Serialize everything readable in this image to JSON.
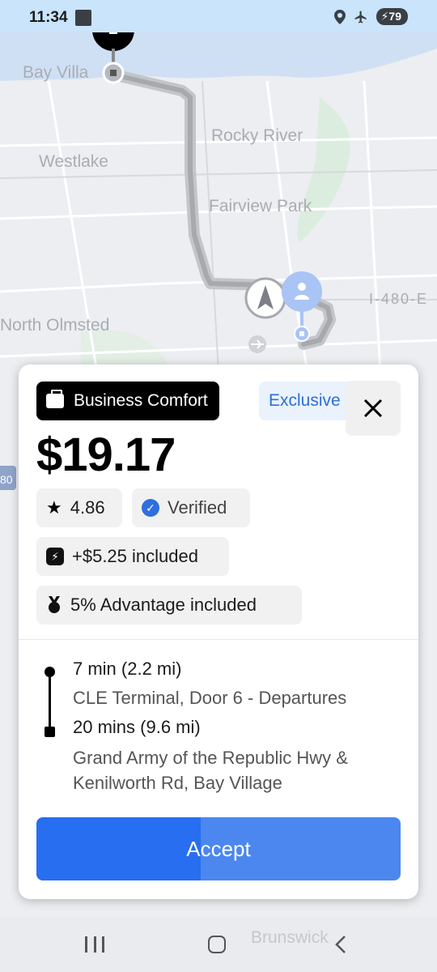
{
  "status_bar": {
    "time": "11:34",
    "battery": "79"
  },
  "map": {
    "labels": {
      "bay_village": "Bay Villa",
      "rocky_river": "Rocky River",
      "westlake": "Westlake",
      "fairview_park": "Fairview Park",
      "i480": "I-480-E",
      "north_olmsted": "North Olmsted",
      "i80": "80",
      "brunswick": "Brunswick"
    }
  },
  "trip_card": {
    "ride_type": "Business Comfort",
    "exclusive_label": "Exclusive",
    "close_symbol": "✕",
    "price": "$19.17",
    "rating": "4.86",
    "verified_label": "Verified",
    "fee_label": "+$5.25 included",
    "advantage_label": "5% Advantage included",
    "pickup_time": "7 min (2.2 mi)",
    "pickup_location": "CLE Terminal, Door 6 - Departures",
    "trip_time": "20 mins (9.6 mi)",
    "dropoff_location": "Grand Army of the Republic Hwy & Kenilworth Rd, Bay Village",
    "accept_label": "Accept",
    "accept_progress": 0.45
  },
  "colors": {
    "accent": "#276ef1",
    "accept_light": "#4b87ef",
    "exclusive_text": "#2d6fd9"
  }
}
